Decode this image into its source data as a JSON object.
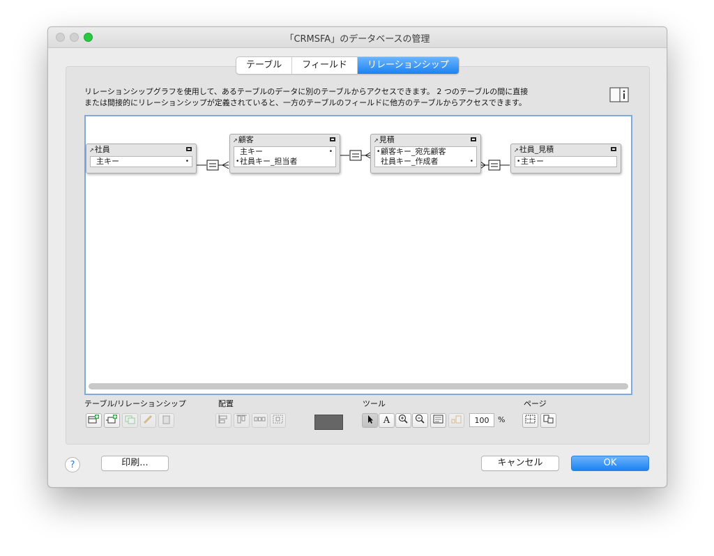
{
  "window": {
    "title": "「CRMSFA」のデータベースの管理"
  },
  "tabs": [
    {
      "label": "テーブル"
    },
    {
      "label": "フィールド"
    },
    {
      "label": "リレーションシップ",
      "active": true
    }
  ],
  "description": {
    "line1": "リレーションシップグラフを使用して、あるテーブルのデータに別のテーブルからアクセスできます。 2 つのテーブルの間に直接",
    "line2": "または間接的にリレーションシップが定義されていると、一方のテーブルのフィールドに他方のテーブルからアクセスできます。"
  },
  "graph": {
    "tables": [
      {
        "name": "社員",
        "fields": [
          "主キー"
        ]
      },
      {
        "name": "顧客",
        "fields": [
          "主キー",
          "社員キー_担当者"
        ]
      },
      {
        "name": "見積",
        "fields": [
          "顧客キー_宛先顧客",
          "社員キー_作成者"
        ]
      },
      {
        "name": "社員_見積",
        "fields": [
          "主キー"
        ]
      }
    ],
    "relation_symbol": "="
  },
  "toolbar": {
    "group_table": "テーブル/リレーションシップ",
    "group_arrange": "配置",
    "group_tools": "ツール",
    "group_page": "ページ",
    "text_tool": "A",
    "zoom_value": "100",
    "zoom_unit": "%"
  },
  "footer": {
    "help": "?",
    "print": "印刷...",
    "cancel": "キャンセル",
    "ok": "OK"
  },
  "colors": {
    "accent": "#1b82f2",
    "selection_border": "#7fa8e0",
    "swatch": "#666666"
  }
}
